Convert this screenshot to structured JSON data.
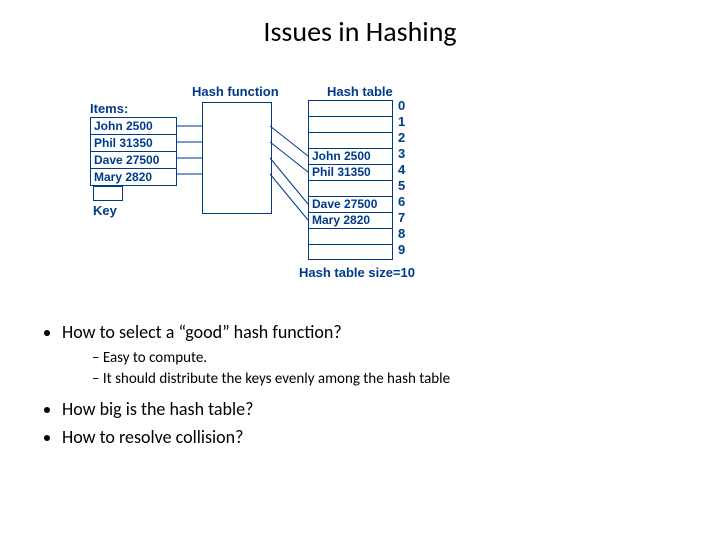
{
  "title": "Issues in Hashing",
  "diagram": {
    "labels": {
      "items": "Items:",
      "hash_function": "Hash function",
      "hash_table": "Hash table",
      "key": "Key",
      "table_size": "Hash table size=10"
    },
    "items": [
      "John  2500",
      "Phil  31350",
      "Dave  27500",
      "Mary  2820"
    ],
    "table_size": 10,
    "table": [
      "",
      "",
      "",
      "John  2500",
      "Phil  31350",
      "",
      "Dave  27500",
      "Mary  2820",
      "",
      ""
    ]
  },
  "bullets": [
    {
      "text": "How to select a “good” hash function?",
      "sub": [
        "Easy to compute.",
        "It should distribute the keys evenly among the hash table"
      ]
    },
    {
      "text": "How big is the hash table?",
      "sub": []
    },
    {
      "text": "How to resolve collision?",
      "sub": []
    }
  ]
}
